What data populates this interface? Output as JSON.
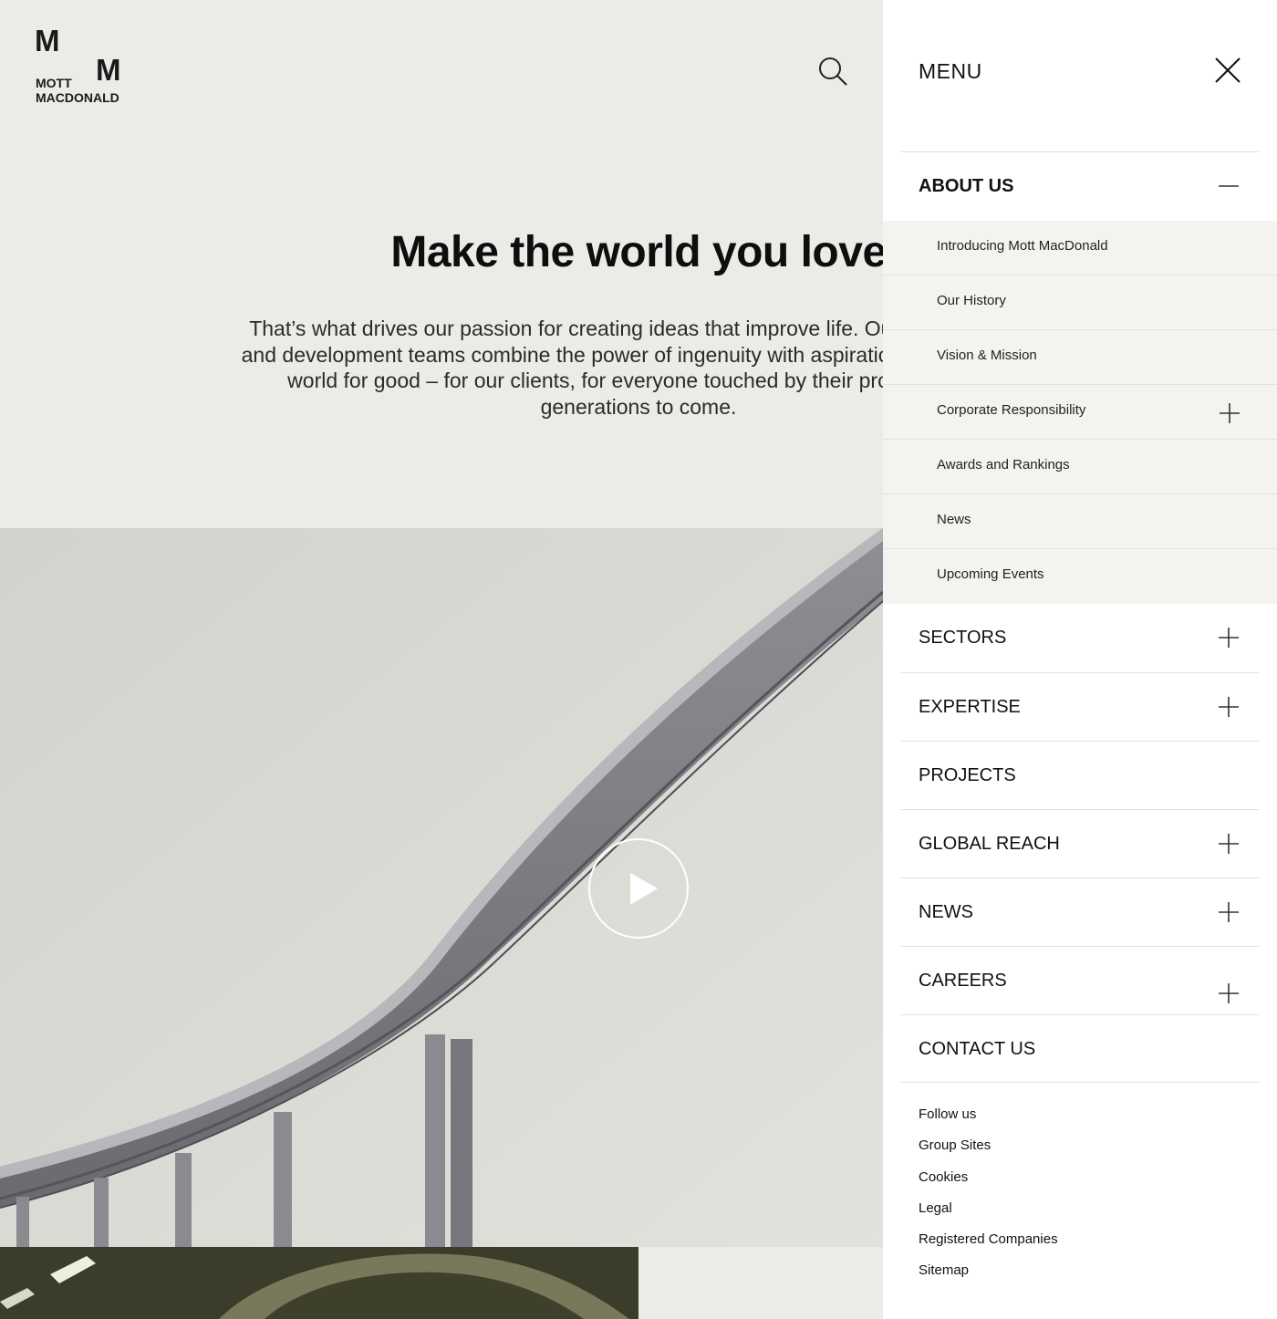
{
  "brand": {
    "logo_letter_top": "M",
    "logo_letter_bottom": "M",
    "logo_line1": "MOTT",
    "logo_line2": "MACDONALD"
  },
  "hero": {
    "title": "Make the world you love",
    "body": "That’s what drives our passion for creating ideas that improve life. Our management and development teams combine the power of ingenuity with aspiration to change our world for good – for our clients, for everyone touched by their projects, even generations to come."
  },
  "menu": {
    "title": "MENU",
    "items": [
      {
        "label": "ABOUT US",
        "state": "expanded"
      },
      {
        "label": "SECTORS",
        "state": "collapsed"
      },
      {
        "label": "EXPERTISE",
        "state": "collapsed"
      },
      {
        "label": "PROJECTS",
        "state": "none"
      },
      {
        "label": "GLOBAL REACH",
        "state": "collapsed"
      },
      {
        "label": "NEWS",
        "state": "collapsed"
      },
      {
        "label": "CAREERS",
        "state": "collapsed"
      },
      {
        "label": "CONTACT US",
        "state": "none"
      }
    ],
    "about_sub_items": [
      {
        "label": "Introducing Mott MacDonald",
        "has_children": false
      },
      {
        "label": "Our History",
        "has_children": false
      },
      {
        "label": "Vision & Mission",
        "has_children": false
      },
      {
        "label": "Corporate Responsibility",
        "has_children": true
      },
      {
        "label": "Awards and Rankings",
        "has_children": false
      },
      {
        "label": "News",
        "has_children": false
      },
      {
        "label": "Upcoming Events",
        "has_children": false
      }
    ],
    "footer_links": [
      "Follow us",
      "Group Sites",
      "Cookies",
      "Legal",
      "Registered Companies",
      "Sitemap"
    ]
  },
  "icons": {
    "search": "search-icon",
    "close": "close-icon",
    "expand": "plus-icon",
    "collapse": "minus-icon",
    "play": "play-icon"
  },
  "colors": {
    "page_bg": "#ecebe7",
    "menu_bg": "#ffffff",
    "submenu_bg": "#f4f3f0",
    "text": "#111111",
    "divider": "#e2e1dd"
  }
}
